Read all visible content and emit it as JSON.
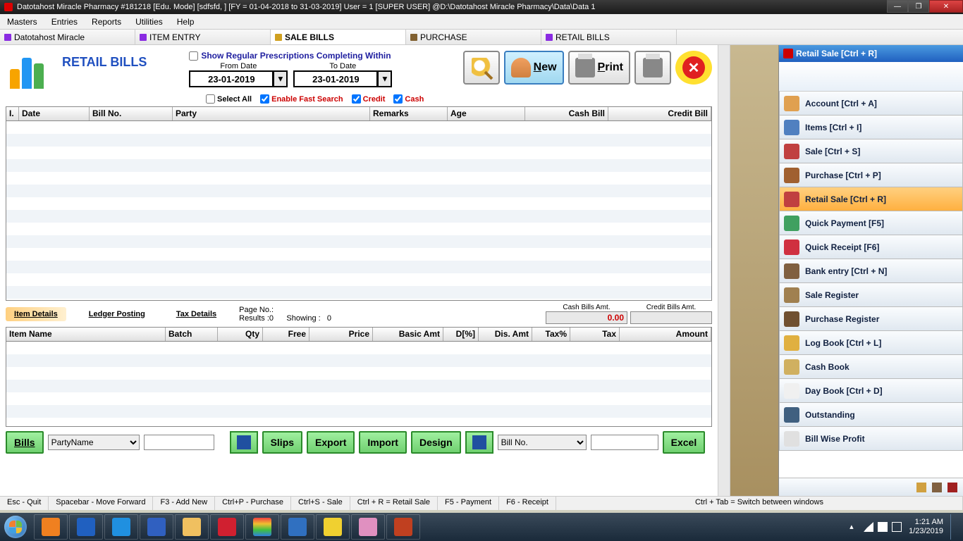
{
  "window": {
    "title": "Datotahost Miracle Pharmacy #181218  [Edu. Mode]  [sdfsfd, ]  [FY = 01-04-2018 to 31-03-2019] User = 1 [SUPER USER]  @D:\\Datotahost Miracle Pharmacy\\Data\\Data 1"
  },
  "menus": [
    "Masters",
    "Entries",
    "Reports",
    "Utilities",
    "Help"
  ],
  "doc_tabs": [
    {
      "label": "Datotahost Miracle"
    },
    {
      "label": "ITEM ENTRY"
    },
    {
      "label": "SALE BILLS",
      "active": true
    },
    {
      "label": "PURCHASE"
    },
    {
      "label": "RETAIL BILLS"
    }
  ],
  "page": {
    "title": "RETAIL BILLS",
    "prescription_label": "Show Regular Prescriptions Completing Within",
    "from_label": "From Date",
    "to_label": "To Date",
    "from_date": "23-01-2019",
    "to_date": "23-01-2019",
    "select_all": "Select All",
    "fast_search": "Enable Fast Search",
    "credit": "Credit",
    "cash": "Cash",
    "new_btn": "New",
    "print_btn": "Print"
  },
  "grid1": {
    "cols": [
      "I.",
      "Date",
      "Bill No.",
      "Party",
      "Remarks",
      "Age",
      "Cash Bill",
      "Credit Bill"
    ]
  },
  "midtabs": [
    "Item Details",
    "Ledger Posting",
    "Tax Details"
  ],
  "stats": {
    "page_label": "Page No.:",
    "results_label": "Results :",
    "results_val": "0",
    "showing_label": "Showing :",
    "showing_val": "0",
    "cash_label": "Cash Bills Amt.",
    "cash_val": "0.00",
    "credit_label": "Credit Bills Amt.",
    "credit_val": ""
  },
  "grid2": {
    "cols": [
      "Item Name",
      "Batch",
      "Qty",
      "Free",
      "Price",
      "Basic Amt",
      "D[%]",
      "Dis. Amt",
      "Tax%",
      "Tax",
      "Amount"
    ]
  },
  "actions": {
    "bills": "Bills",
    "party_select": "PartyName",
    "slips": "Slips",
    "export": "Export",
    "import": "Import",
    "design": "Design",
    "billno": "Bill No.",
    "excel": "Excel"
  },
  "right_panel": {
    "title": "Retail Sale [Ctrl + R]",
    "items": [
      {
        "label": "Account [Ctrl + A]",
        "color": "#e0a050"
      },
      {
        "label": "Items [Ctrl + I]",
        "color": "#5080c0"
      },
      {
        "label": "Sale [Ctrl + S]",
        "color": "#c04040"
      },
      {
        "label": "Purchase [Ctrl + P]",
        "color": "#a06030"
      },
      {
        "label": "Retail Sale [Ctrl + R]",
        "color": "#c04040",
        "selected": true
      },
      {
        "label": "Quick Payment [F5]",
        "color": "#40a060"
      },
      {
        "label": "Quick Receipt [F6]",
        "color": "#d03040"
      },
      {
        "label": "Bank entry [Ctrl + N]",
        "color": "#806040"
      },
      {
        "label": "Sale Register",
        "color": "#a08050"
      },
      {
        "label": "Purchase Register",
        "color": "#705030"
      },
      {
        "label": "Log Book [Ctrl + L]",
        "color": "#e0b040"
      },
      {
        "label": "Cash Book",
        "color": "#d0b060"
      },
      {
        "label": "Day Book [Ctrl + D]",
        "color": "#f0f0f0"
      },
      {
        "label": "Outstanding",
        "color": "#406080"
      },
      {
        "label": "Bill Wise Profit",
        "color": "#e0e0e0"
      }
    ]
  },
  "shortcuts": [
    "Esc - Quit",
    "Spacebar - Move Forward",
    "F3 - Add New",
    "Ctrl+P - Purchase",
    "Ctrl+S - Sale",
    "Ctrl + R = Retail Sale",
    "F5 - Payment",
    "F6 - Receipt",
    "Ctrl + Tab = Switch between windows"
  ],
  "taskbar": {
    "time": "1:21 AM",
    "date": "1/23/2019",
    "apps": [
      {
        "c": "#f08020"
      },
      {
        "c": "#2060c0"
      },
      {
        "c": "#2090e0"
      },
      {
        "c": "#3060c0"
      },
      {
        "c": "#f0c060"
      },
      {
        "c": "#d02030"
      },
      {
        "c": "linear-gradient(#f04040,#f0c030,#40c040,#3080e0)"
      },
      {
        "c": "#3070c0"
      },
      {
        "c": "#f0d030"
      },
      {
        "c": "#e090c0"
      },
      {
        "c": "#c04020"
      }
    ]
  }
}
